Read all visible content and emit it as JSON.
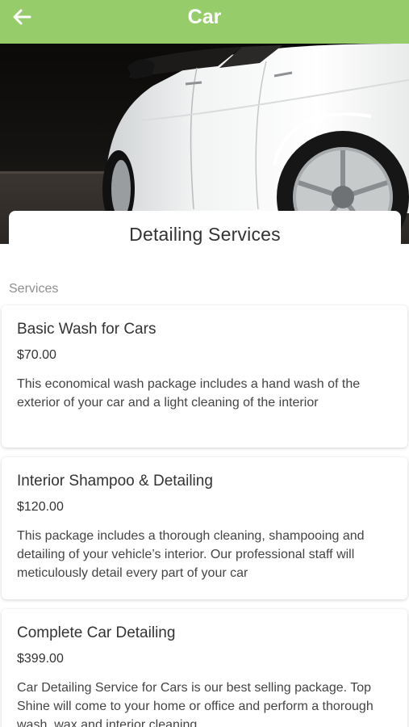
{
  "header": {
    "title": "Car",
    "back_icon": "arrow-left-icon",
    "color": "#96cc6a"
  },
  "hero": {
    "image": "white car side view photo"
  },
  "title_card": {
    "title": "Detailing Services"
  },
  "section": {
    "label": "Services"
  },
  "services": [
    {
      "name": "Basic Wash for Cars",
      "price": "$70.00",
      "description": "This economical wash package includes a hand wash of the exterior of your car and a light cleaning of the interior"
    },
    {
      "name": "Interior Shampoo & Detailing",
      "price": "$120.00",
      "description": "This package includes a thorough cleaning, shampooing and detailing of your vehicle’s interior. Our professional staff will meticulously detail every part of your car"
    },
    {
      "name": "Complete Car Detailing",
      "price": "$399.00",
      "description": "Car Detailing Service for Cars is our best selling package. Top Shine will come to your home or office and perform a thorough wash, wax and interior cleaning"
    }
  ]
}
